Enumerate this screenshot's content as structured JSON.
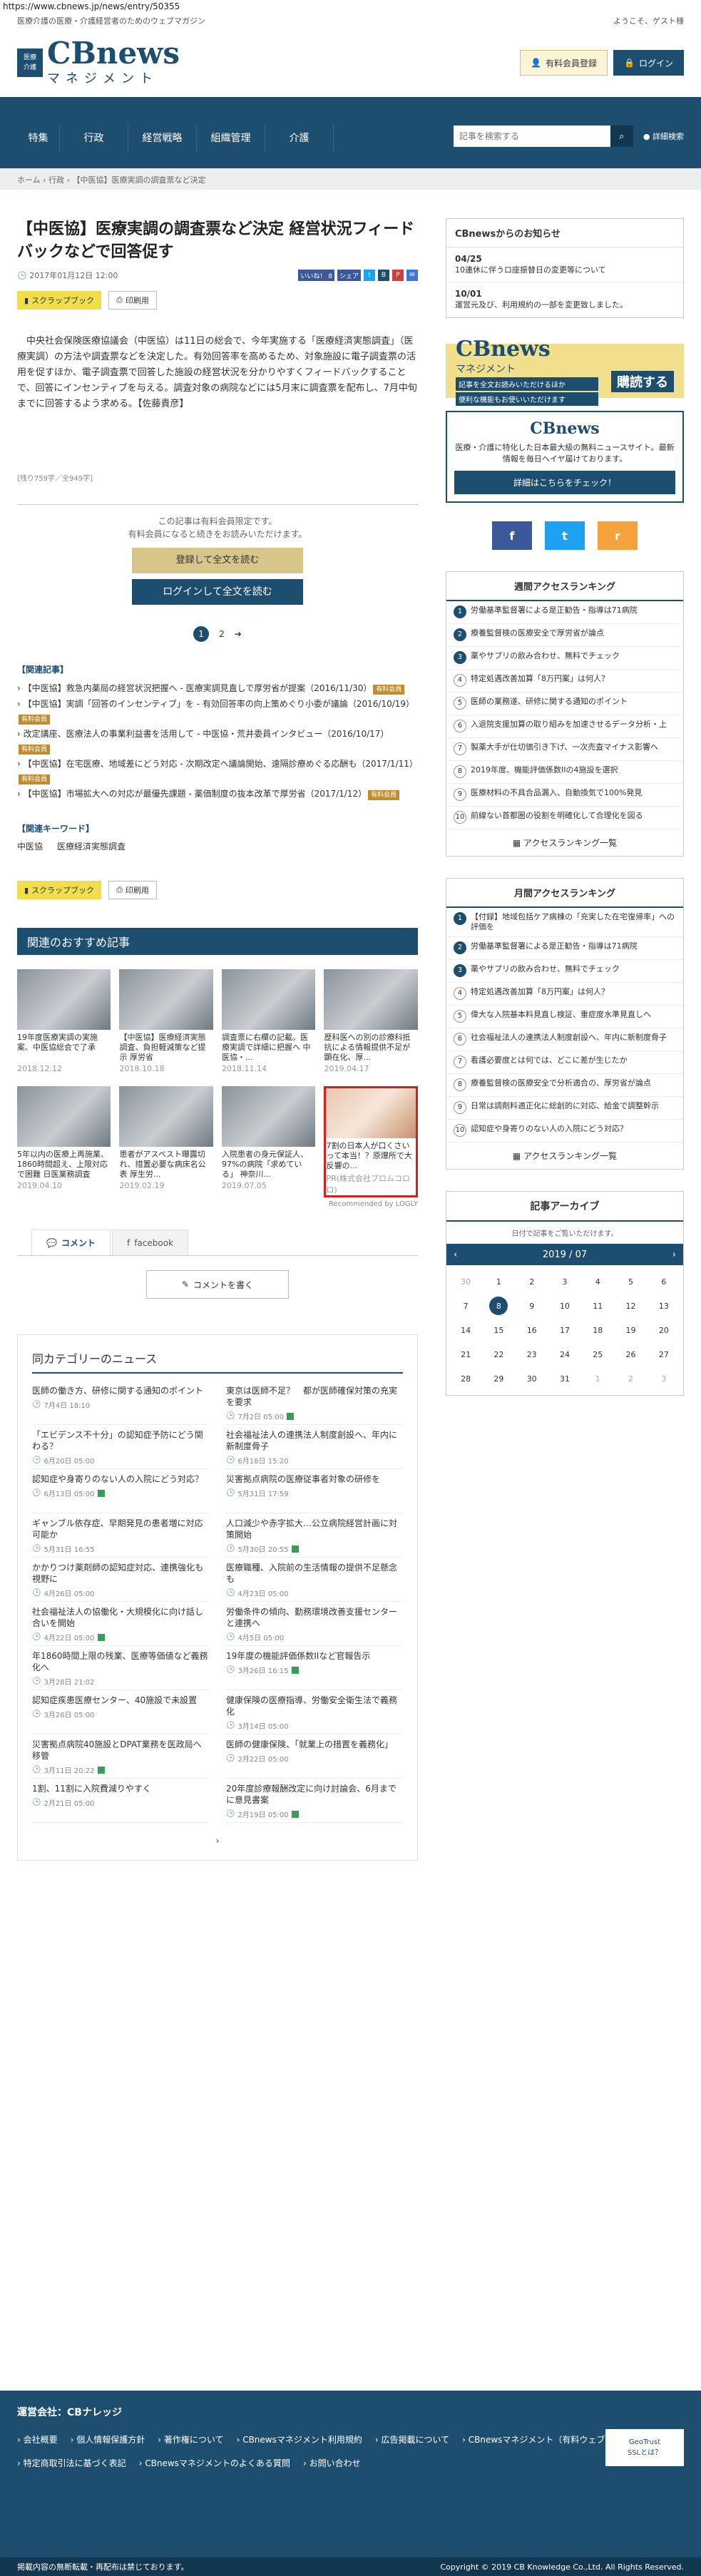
{
  "url": "https://www.cbnews.jp/news/entry/50355",
  "topbar": {
    "tagline": "医療介護の医療・介護経営者のためのウェブマガジン",
    "welcome": "ようこそ、ゲスト様"
  },
  "logo": {
    "badge_top": "医療",
    "badge_bot": "介護",
    "title": "CBnews",
    "sub": "マネジメント"
  },
  "header": {
    "paid_label": "有料会員登録",
    "login_label": "ログイン"
  },
  "nav": {
    "items": [
      "特集",
      "行政",
      "経営戦略",
      "組織管理",
      "介護"
    ],
    "search_placeholder": "記事を検索する",
    "advanced": "詳細検索"
  },
  "breadcrumb": [
    "ホーム",
    "行政",
    "【中医協】医療実調の調査票など決定"
  ],
  "article": {
    "title": "【中医協】医療実調の調査票など決定 経営状況フィードバックなどで回答促す",
    "date": "2017年01月12日 12:00",
    "social": {
      "like": "いいね！ 8",
      "share": "シェア"
    },
    "scrapbook": "スクラップブック",
    "print": "印刷用",
    "body": "中央社会保険医療協議会（中医協）は11日の総会で、今年実施する「医療経済実態調査」（医療実調）の方法や調査票などを決定した。有効回答率を高めるため、対象施設に電子調査票の活用を促すほか、電子調査票で回答した施設の経営状況を分かりやすくフィードバックすることで、回答にインセンティブを与える。調査対象の病院などには5月末に調査票を配布し、7月中旬までに回答するよう求める。【佐藤貴彦】",
    "counts": "[残り759字／全949字]",
    "paywall": {
      "line1": "この記事は有料会員限定です。",
      "line2": "有料会員になると続きをお読みいただけます。",
      "register": "登録して全文を読む",
      "login": "ログインして全文を読む"
    },
    "pager": [
      "1",
      "2"
    ],
    "related_heading": "【関連記事】",
    "related": [
      {
        "text": "【中医協】救急内薬局の経営状況把握へ - 医療実調見直しで厚労省が提案（2016/11/30）",
        "badge": "有料会員"
      },
      {
        "text": "【中医協】実調「回答のインセンティブ」を - 有効回答率の向上策めぐり小委が議論（2016/10/19）",
        "badge": "有料会員"
      },
      {
        "text": "改定講座、医療法人の事業利益書を活用して - 中医協・荒井委員インタビュー（2016/10/17）",
        "badge": "有料会員"
      },
      {
        "text": "【中医協】在宅医療、地域差にどう対応 - 次期改定へ議論開始、遠隔診療めぐる応酬も（2017/1/11）",
        "badge": "有料会員"
      },
      {
        "text": "【中医協】市場拡大への対応が最優先課題 - 薬価制度の抜本改革で厚労省（2017/1/12）",
        "badge": "有料会員"
      }
    ],
    "keyword_heading": "【関連キーワード】",
    "keywords": [
      "中医協",
      "医療経済実態調査"
    ]
  },
  "recommend": {
    "heading": "関連のおすすめ記事",
    "cards": [
      {
        "title": "19年度医療実調の実施案、中医協総会で了承",
        "date": "2018.12.12"
      },
      {
        "title": "【中医協】医療経済実態調査、負担軽減策など提示 厚労省",
        "date": "2018.10.18"
      },
      {
        "title": "調査票に右欄の記載。医療実調で詳細に把握へ 中医協・...",
        "date": "2018.11.14"
      },
      {
        "title": "歴科医への別の診療科抵抗による情報提供不足が顕在化、厚...",
        "date": "2019.04.17"
      },
      {
        "title": "5年以内の医療上再施業、1860時間超え、上限対応で困難 日医業務調査",
        "date": "2019.04.10"
      },
      {
        "title": "患者がアスベスト曝露切れ、措置必要な病床名公表 厚生労...",
        "date": "2019.02.19"
      },
      {
        "title": "入院患者の身元保証人、97%の病院「求めている」 神奈川...",
        "date": "2019.07.05"
      },
      {
        "title": "7割の日本人が口くさいって本当！？原爆所で大反響の...",
        "date": "PR(株式会社ブロムコロロ)"
      }
    ],
    "logly": "Recommended by LOGLY"
  },
  "tabs": {
    "comment": "コメント",
    "facebook": "facebook",
    "write": "コメントを書く"
  },
  "samecat": {
    "heading": "同カテゴリーのニュース",
    "items": [
      {
        "t": "医師の働き方、研修に関する通知のポイント",
        "d": "7月4日 18:10"
      },
      {
        "t": "東京は医師不足？　都が医師確保対策の充実を要求",
        "d": "7月2日 05:00"
      },
      {
        "t": "「エビデンス不十分」の認知症予防にどう関わる？",
        "d": "6月20日 05:00"
      },
      {
        "t": "社会福祉法人の連携法人制度創設へ、年内に新制度骨子",
        "d": "6月18日 15:20"
      },
      {
        "t": "認知症や身寄りのない人の入院にどう対応？",
        "d": "6月13日 05:00"
      },
      {
        "t": "災害拠点病院の医療従事者対象の研修を",
        "d": "5月31日 17:59"
      },
      {
        "t": "ギャンブル依存症、早期発見の患者増に対応可能か",
        "d": "5月31日 16:55"
      },
      {
        "t": "人口減少や赤字拡大…公立病院経営計画に対策開始",
        "d": "5月30日 20:55"
      },
      {
        "t": "かかりつけ薬剤師の認知症対応、連携強化も視野に",
        "d": "4月26日 05:00"
      },
      {
        "t": "医療職種、入院前の生活情報の提供不足懸念も",
        "d": "4月23日 05:00"
      },
      {
        "t": "社会福祉法人の協働化・大規模化に向け話し合いを開始",
        "d": "4月22日 05:00"
      },
      {
        "t": "労働条件の傾向、勤務環境改善支援センターと連携へ",
        "d": "4月5日 05:00"
      },
      {
        "t": "年1860時間上限の残業、医療等価値など義務化へ",
        "d": "3月28日 21:02"
      },
      {
        "t": "19年度の機能評価係数IIなど官報告示",
        "d": "3月26日 16:15"
      },
      {
        "t": "認知症疾患医療センター、40施設で未設置",
        "d": "3月26日 05:00"
      },
      {
        "t": "健康保険の医療指導、労働安全衛生法で義務化",
        "d": "3月14日 05:00"
      },
      {
        "t": "災害拠点病院40施設とDPAT業務を医政局へ移管",
        "d": "3月11日 20:22"
      },
      {
        "t": "医師の健康保険、「就業上の措置を義務化」",
        "d": "2月22日 05:00"
      },
      {
        "t": "1割、11割に入院費減りやすく",
        "d": "2月21日 05:00"
      },
      {
        "t": "20年度診療報酬改定に向け討論会、6月までに意見書案",
        "d": "2月19日 05:00"
      }
    ],
    "more_label": "›"
  },
  "sidebar": {
    "notice_heading": "CBnewsからのお知らせ",
    "notices": [
      {
        "date": "04/25",
        "text": "10連休に伴うロ座振替日の変更等について"
      },
      {
        "date": "10/01",
        "text": "運営元及び、利用規約の一部を変更致しました。"
      }
    ],
    "banner1": {
      "title": "CBnews",
      "sub": "マネジメント",
      "line1": "記事を全文お読みいただけるほか",
      "line2": "便利な機能もお使いいただけます",
      "button": "購読する"
    },
    "banner2": {
      "title": "CBnews",
      "desc": "医療・介護に特化した日本最大級の無料ニュースサイト。最新情報を毎日ヘイヤ届けております。",
      "button": "詳細はこちらをチェック！"
    },
    "sns": {
      "facebook": "f",
      "twitter": "t",
      "rss": "r"
    },
    "weekly": {
      "heading": "週間アクセスランキング",
      "items": [
        "労働基準監督署による是正勧告・指導は71病院",
        "療養監督検の医療安全で厚労省が論点",
        "薬やサプリの飲み合わせ、無料でチェック",
        "特定処遇改善加算「8万円案」は何人？",
        "医師の業務遂、研修に関する通知のポイント",
        "入退院支援加算の取り組みを加速させるデータ分析・上",
        "製薬大手が仕切価引き下げ、一次売査マイナス影響へ",
        "2019年度、機能評価係数IIの4施設を選択",
        "医療材料の不具合品漏入、自動換気で100%発見",
        "前線ない首都圏の役割を明確化して合理化を図る"
      ],
      "more": "アクセスランキング一覧"
    },
    "monthly": {
      "heading": "月間アクセスランキング",
      "items": [
        "【付録】地域包括ケア病棟の「充実した在宅復帰率」への評価を",
        "労働基準監督署による是正勧告・指導は71病院",
        "薬やサプリの飲み合わせ、無料でチェック",
        "特定処遇改善加算「8万円案」は何人？",
        "偉大な入院基本料見直し検証、重症度水準見直しへ",
        "社会福祉法人の連携法人制度創設へ、年内に新制度骨子",
        "看護必要度とは何では、どこに差が生じたか",
        "療養監督検の医療安全で分析適合の、厚労省が論点",
        "日常は調剤料適正化に総創的に対応、給金で調整幹示",
        "認知症や身寄りのない人の入院にどう対応？"
      ],
      "more": "アクセスランキング一覧"
    },
    "calendar": {
      "heading": "記事アーカイブ",
      "note": "日付で記事をご覧いただけます。",
      "month": "2019 / 07",
      "days": [
        "30",
        "1",
        "2",
        "3",
        "4",
        "5",
        "6",
        "7",
        "8",
        "9",
        "10",
        "11",
        "12",
        "13",
        "14",
        "15",
        "16",
        "17",
        "18",
        "19",
        "20",
        "21",
        "22",
        "23",
        "24",
        "25",
        "26",
        "27",
        "28",
        "29",
        "30",
        "31",
        "1",
        "2",
        "3"
      ]
    }
  },
  "footer": {
    "company": "運営会社：CBナレッジ",
    "links": [
      "会社概要",
      "個人情報保護方針",
      "著作権について",
      "CBnewsマネジメント利用規約",
      "広告掲載について",
      "CBnewsマネジメント（有料ウェブマガジン）とは",
      "特定商取引法に基づく表記",
      "CBnewsマネジメントのよくある質問",
      "お問い合わせ"
    ],
    "notice": "掲載内容の無断転載・再配布は禁じております。",
    "copyright": "Copyright © 2019 CB Knowledge Co.,Ltd. All Rights Reserved.",
    "gtrust": "GeoTrust",
    "ssl": "SSLとは？"
  },
  "colors": {
    "brand": "#1d4e6f",
    "gold": "#d7c58a",
    "yellow": "#f2dd4b"
  }
}
